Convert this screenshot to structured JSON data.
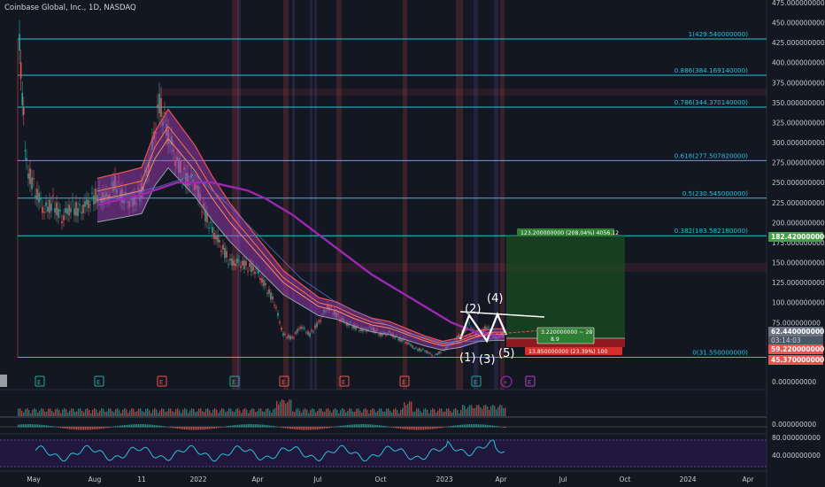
{
  "header": {
    "title": "Coinbase Global, Inc., 1D, NASDAQ"
  },
  "colors": {
    "background": "#131722",
    "fib": "#26c6da",
    "up": "#26a69a",
    "down": "#ef5350",
    "purple": "#9c27b0",
    "ribbon": "#b040c8",
    "green_box": "#1b5e20",
    "red_box": "#b71c1c"
  },
  "price_axis": {
    "labels": [
      "475.000000000",
      "450.000000000",
      "425.000000000",
      "400.000000000",
      "375.000000000",
      "350.000000000",
      "325.000000000",
      "300.000000000",
      "275.000000000",
      "250.000000000",
      "225.000000000",
      "200.000000000",
      "175.000000000",
      "150.000000000",
      "125.000000000",
      "100.000000000",
      "75.000000000",
      "62.440000000",
      "03:14:03",
      "59.220000000",
      "45.370000000",
      "0.000000000",
      "0.000000000",
      "80.000000000",
      "40.000000000"
    ],
    "badges": [
      {
        "text": "182.420000000",
        "color": "#43a047"
      },
      {
        "text": "62.440000000",
        "color": "#6b7280"
      },
      {
        "text": "59.220000000",
        "color": "#ef5350"
      },
      {
        "text": "45.370000000",
        "color": "#ef5350"
      }
    ]
  },
  "fib_levels": [
    {
      "label": "1(429.540000000)",
      "value": 429.54
    },
    {
      "label": "0.886(384.169140000)",
      "value": 384.169
    },
    {
      "label": "0.786(344.370140000)",
      "value": 344.37
    },
    {
      "label": "0.618(277.507820000)",
      "value": 277.508
    },
    {
      "label": "0.5(230.545000000)",
      "value": 230.545
    },
    {
      "label": "0.382(183.582180000)",
      "value": 183.582
    },
    {
      "label": "0(31.550000000)",
      "value": 31.55
    }
  ],
  "time_axis": [
    "May",
    "Aug",
    "11",
    "2022",
    "Apr",
    "Jul",
    "Oct",
    "2023",
    "Apr",
    "Jul",
    "Oct",
    "2024",
    "Apr"
  ],
  "waves": [
    "(1)",
    "(2)",
    "(3)",
    "(4)",
    "(5)"
  ],
  "position_tool": {
    "target": "123.200000000 (208.04%) 4056.12",
    "stop": "13.850000000 (23.39%) 100",
    "center_line1": "3.220000000 ~ 28",
    "center_line2": "8.9"
  },
  "events": [
    "E",
    "E",
    "E",
    "E",
    "E",
    "E",
    "E",
    "E",
    "E",
    "E"
  ],
  "chart_data": {
    "type": "line",
    "title": "Coinbase Global, Inc., 1D, NASDAQ",
    "x": [
      "2021-04",
      "2021-05",
      "2021-06",
      "2021-07",
      "2021-08",
      "2021-09",
      "2021-10",
      "2021-11",
      "2021-12",
      "2022-01",
      "2022-02",
      "2022-03",
      "2022-04",
      "2022-05",
      "2022-06",
      "2022-07",
      "2022-08",
      "2022-09",
      "2022-10",
      "2022-11",
      "2022-12",
      "2023-01",
      "2023-02",
      "2023-03",
      "2023-04"
    ],
    "series": [
      {
        "values": [
          420,
          240,
          220,
          230,
          250,
          240,
          260,
          350,
          280,
          230,
          190,
          180,
          160,
          80,
          55,
          60,
          95,
          70,
          65,
          50,
          35,
          48,
          65,
          55,
          62.44
        ]
      }
    ],
    "ylim": [
      0,
      475
    ]
  }
}
